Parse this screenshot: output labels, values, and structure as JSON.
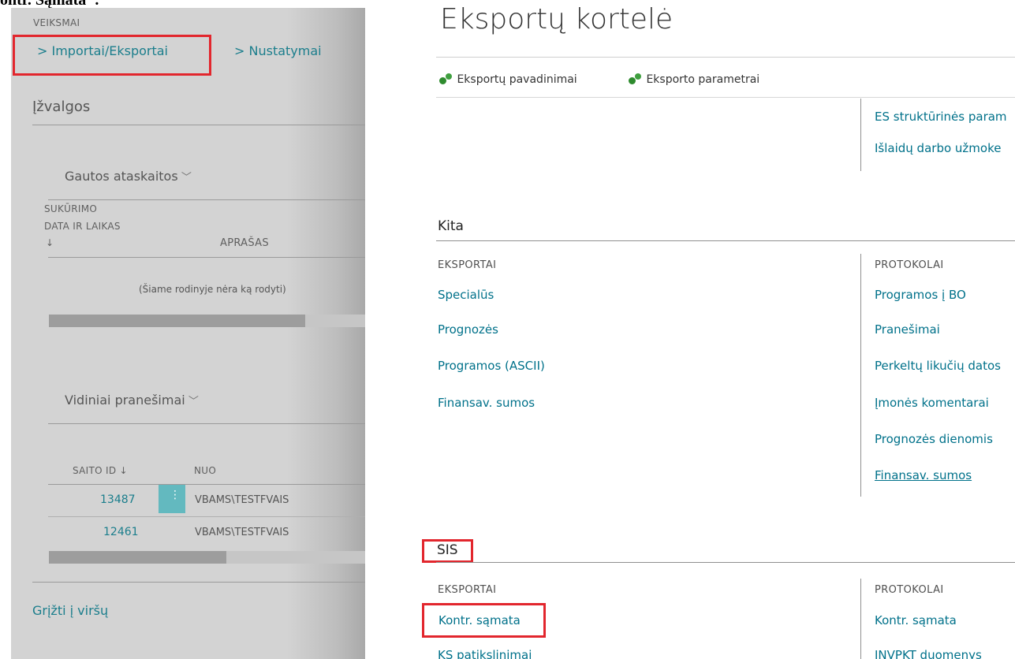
{
  "doc_caption": "ontr. Sąmata\".",
  "left": {
    "actions_heading": "VEIKSMAI",
    "actions": [
      {
        "label": "> Importai/Eksportai"
      },
      {
        "label": "> Nustatymai"
      }
    ],
    "insights_title": "Įžvalgos",
    "reports": {
      "title": "Gautos ataskaitos",
      "col1_line1": "SUKŪRIMO",
      "col1_line2": "DATA IR LAIKAS",
      "col1_sort": "↓",
      "col2": "APRAŠAS",
      "empty": "(Šiame rodinyje nėra ką rodyti)"
    },
    "messages": {
      "title": "Vidiniai pranešimai",
      "col_id": "SAITO ID ↓",
      "col_from": "NUO",
      "rows": [
        {
          "id": "13487",
          "from": "VBAMS\\TESTFVAIS"
        },
        {
          "id": "12461",
          "from": "VBAMS\\TESTFVAIS"
        }
      ]
    },
    "back_to_top": "Grįžti į viršų"
  },
  "right": {
    "title": "Eksportų kortelė",
    "toolbar": [
      {
        "label": "Eksportų pavadinimai",
        "icon": "gears-icon"
      },
      {
        "label": "Eksporto parametrai",
        "icon": "gears-icon"
      }
    ],
    "top_links": [
      "ES struktūrinės param",
      "Išlaidų darbo užmoke"
    ],
    "kita": {
      "title": "Kita",
      "exports_heading": "EKSPORTAI",
      "exports": [
        "Specialūs",
        "Prognozės",
        "Programos (ASCII)",
        "Finansav. sumos"
      ],
      "protocols_heading": "PROTOKOLAI",
      "protocols": [
        "Programos į BO",
        "Pranešimai",
        "Perkeltų likučių datos",
        "Įmonės komentarai",
        "Prognozės dienomis",
        "Finansav. sumos"
      ]
    },
    "sis": {
      "title": "SIS",
      "exports_heading": "EKSPORTAI",
      "exports": [
        "Kontr. sąmata",
        "KS patikslinimai"
      ],
      "protocols_heading": "PROTOKOLAI",
      "protocols": [
        "Kontr. sąmata",
        "INVPKT duomenys"
      ]
    }
  }
}
